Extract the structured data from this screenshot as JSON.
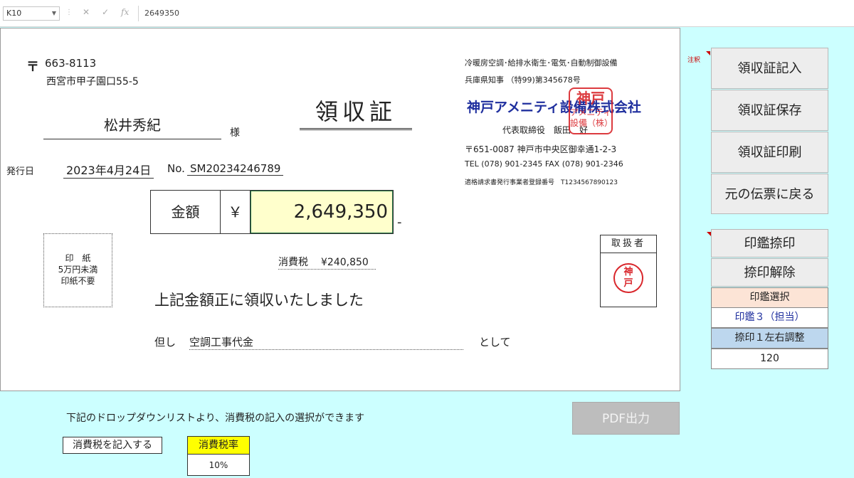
{
  "formula_bar": {
    "cell_ref": "K10",
    "value": "2649350",
    "icons": [
      "chevron-down-icon",
      "cancel-icon",
      "check-icon",
      "function-icon"
    ]
  },
  "receipt": {
    "postal_mark": "〒",
    "postal_code": "663-8113",
    "address": "西宮市甲子園口55-5",
    "customer_name": "松井秀紀",
    "honorific": "様",
    "title": "領収証",
    "issue_label": "発行日",
    "issue_date": "2023年4月24日",
    "no_label": "No.",
    "no_value": "SM20234246789",
    "amount_label": "金額",
    "currency": "￥",
    "amount": "2,649,350",
    "amount_suffix": "-",
    "stamp_box": [
      "印　紙",
      "5万円未満",
      "印紙不要"
    ],
    "tax_label": "消費税",
    "tax_value": "¥240,850",
    "received_message": "上記金額正に領収いたしました",
    "tadashi": "但し",
    "purpose": "空調工事代金",
    "toshite": "として",
    "handler_label": "取扱者",
    "handler_seal": [
      "神",
      "戸"
    ]
  },
  "company": {
    "line1": "冷暖房空調･給排水衛生･電気･自動制御設備",
    "line2": "兵庫県知事 （特99)第345678号",
    "name": "神戸アメニティ設備株式会社",
    "representative": "代表取締役　飯田　好",
    "address": "〒651-0087 神戸市中央区御幸通1-2-3",
    "tel": "TEL (078) 901-2345 FAX (078) 901-2346",
    "registration": "適格請求書発行事業者登録番号　T1234567890123",
    "seal_lines": [
      "神戸",
      "アメニティ",
      "設備（株）"
    ]
  },
  "panel": {
    "comment_label": "注釈",
    "buttons": {
      "write": "領収証記入",
      "save": "領収証保存",
      "print": "領収証印刷",
      "back": "元の伝票に戻る",
      "seal": "印鑑捺印",
      "unseal": "捺印解除"
    },
    "seal_select_label": "印鑑選択",
    "seal_select_value": "印鑑３（担当）",
    "adjust_label": "捺印１左右調整",
    "adjust_value": "120"
  },
  "bottom": {
    "note": "下記のドロップダウンリストより、消費税の記入の選択ができます",
    "tax_toggle": "消費税を記入する",
    "rate_label": "消費税率",
    "rate_value": "10%",
    "pdf_button": "PDF出力"
  },
  "colors": {
    "background": "#ccffff",
    "seal_red": "#d9262b",
    "company_blue": "#1f2f9e",
    "amount_fill": "#ffffcc",
    "rate_header": "#ffff00",
    "seal_select_header": "#fce4d6",
    "adjust_header": "#bdd7ee"
  }
}
